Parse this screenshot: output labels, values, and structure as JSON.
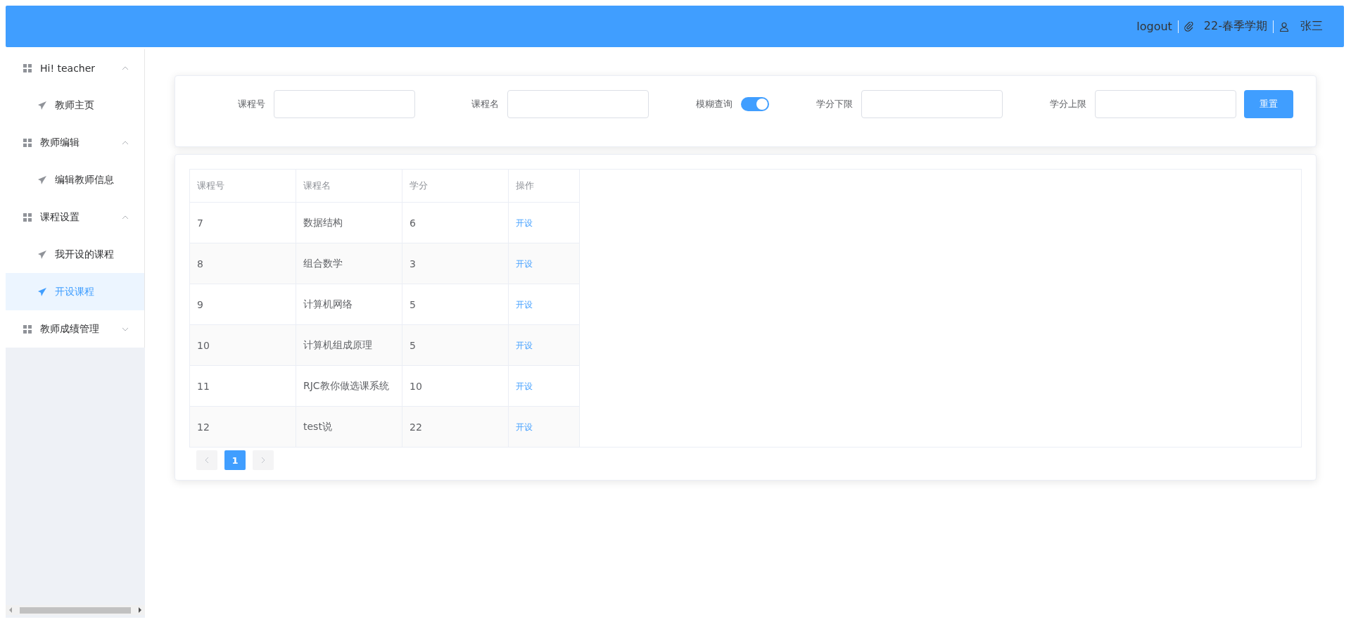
{
  "header": {
    "logout": "logout",
    "term": "22-春季学期",
    "user": "张三"
  },
  "sidebar": {
    "groups": [
      {
        "label": "Hi! teacher",
        "expanded": true,
        "children": [
          {
            "label": "教师主页",
            "selected": false
          }
        ]
      },
      {
        "label": "教师编辑",
        "expanded": true,
        "children": [
          {
            "label": "编辑教师信息",
            "selected": false
          }
        ]
      },
      {
        "label": "课程设置",
        "expanded": true,
        "children": [
          {
            "label": "我开设的课程",
            "selected": false
          },
          {
            "label": "开设课程",
            "selected": true
          }
        ]
      },
      {
        "label": "教师成绩管理",
        "expanded": false
      }
    ]
  },
  "filters": [
    {
      "kind": "input",
      "label": "课程号"
    },
    {
      "kind": "input",
      "label": "课程名"
    },
    {
      "kind": "switch",
      "label": "模糊查询",
      "on": true
    },
    {
      "kind": "input",
      "label": "学分下限"
    },
    {
      "kind": "input",
      "label": "学分上限"
    }
  ],
  "reset_button": "重置",
  "table": {
    "columns": [
      "课程号",
      "课程名",
      "学分",
      "操作"
    ],
    "rows": [
      {
        "id": "7",
        "name": "数据结构",
        "credit": "6",
        "action": "开设"
      },
      {
        "id": "8",
        "name": "组合数学",
        "credit": "3",
        "action": "开设"
      },
      {
        "id": "9",
        "name": "计算机网络",
        "credit": "5",
        "action": "开设"
      },
      {
        "id": "10",
        "name": "计算机组成原理",
        "credit": "5",
        "action": "开设"
      },
      {
        "id": "11",
        "name": "RJC教你做选课系统",
        "credit": "10",
        "action": "开设"
      },
      {
        "id": "12",
        "name": "test说",
        "credit": "22",
        "action": "开设"
      }
    ]
  },
  "pagination": {
    "pages": [
      {
        "label": "1",
        "selected": true
      }
    ]
  }
}
